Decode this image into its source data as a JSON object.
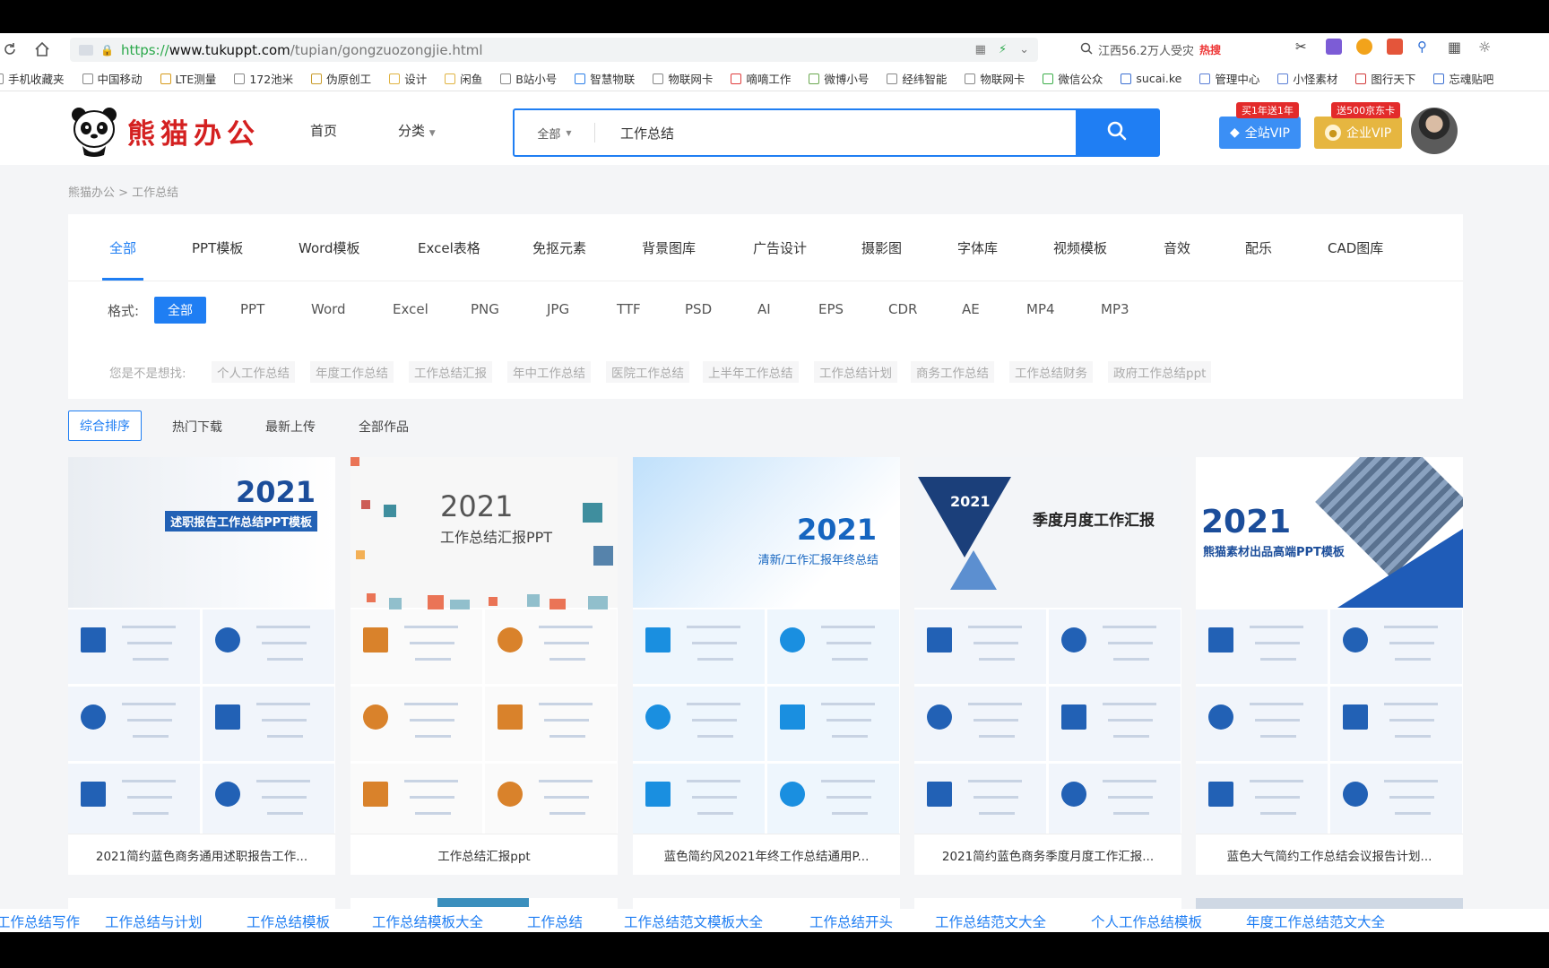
{
  "browser": {
    "url_prefix": "https://",
    "url_host": "www.tukuppt.com",
    "url_path": "/tupian/gongzuozongjie.html",
    "search_text": "江西56.2万人受灾",
    "search_hot": "热搜"
  },
  "bookmarks": [
    "手机收藏夹",
    "中国移动",
    "LTE测量",
    "172池米",
    "伪原创工",
    "设计",
    "闲鱼",
    "B站小号",
    "智慧物联",
    "物联网卡",
    "嘀嘀工作",
    "微博小号",
    "经纬智能",
    "物联网卡",
    "微信公众",
    "sucai.ke",
    "管理中心",
    "小怪素材",
    "图行天下",
    "忘魂贴吧"
  ],
  "site": {
    "logo_text": "熊猫办公",
    "nav_home": "首页",
    "nav_category": "分类",
    "search_category": "全部",
    "search_value": "工作总结",
    "vip_all": "全站VIP",
    "vip_all_tag": "买1年送1年",
    "vip_ent": "企业VIP",
    "vip_ent_tag": "送500京东卡"
  },
  "breadcrumb": "熊猫办公 > 工作总结",
  "tabs": [
    "全部",
    "PPT模板",
    "Word模板",
    "Excel表格",
    "免抠元素",
    "背景图库",
    "广告设计",
    "摄影图",
    "字体库",
    "视频模板",
    "音效",
    "配乐",
    "CAD图库"
  ],
  "formats": {
    "label": "格式:",
    "items": [
      "全部",
      "PPT",
      "Word",
      "Excel",
      "PNG",
      "JPG",
      "TTF",
      "PSD",
      "AI",
      "EPS",
      "CDR",
      "AE",
      "MP4",
      "MP3"
    ]
  },
  "suggest": {
    "label": "您是不是想找:",
    "items": [
      "个人工作总结",
      "年度工作总结",
      "工作总结汇报",
      "年中工作总结",
      "医院工作总结",
      "上半年工作总结",
      "工作总结计划",
      "商务工作总结",
      "工作总结财务",
      "政府工作总结ppt"
    ]
  },
  "sort": [
    "综合排序",
    "热门下载",
    "最新上传",
    "全部作品"
  ],
  "cards": [
    {
      "title": "2021简约蓝色商务通用述职报告工作...",
      "year": "2021",
      "heading": "述职报告工作总结PPT模板"
    },
    {
      "title": "工作总结汇报ppt",
      "year": "2021",
      "heading": "工作总结汇报PPT"
    },
    {
      "title": "蓝色简约风2021年终工作总结通用P...",
      "year": "2021",
      "heading": "清新/工作汇报年终总结"
    },
    {
      "title": "2021简约蓝色商务季度月度工作汇报...",
      "year": "2021",
      "heading": "季度月度工作汇报"
    },
    {
      "title": "蓝色大气简约工作总结会议报告计划...",
      "year": "2021",
      "heading": "熊猫素材出品高端PPT模板"
    }
  ],
  "bottom_links": [
    "工作总结写作",
    "工作总结与计划",
    "工作总结模板",
    "工作总结模板大全",
    "工作总结",
    "工作总结范文模板大全",
    "工作总结开头",
    "工作总结范文大全",
    "个人工作总结模板",
    "年度工作总结范文大全"
  ],
  "colors": {
    "accent": "#1f7ef3",
    "brand": "#d42020",
    "dark_blue": "#2261b5"
  }
}
